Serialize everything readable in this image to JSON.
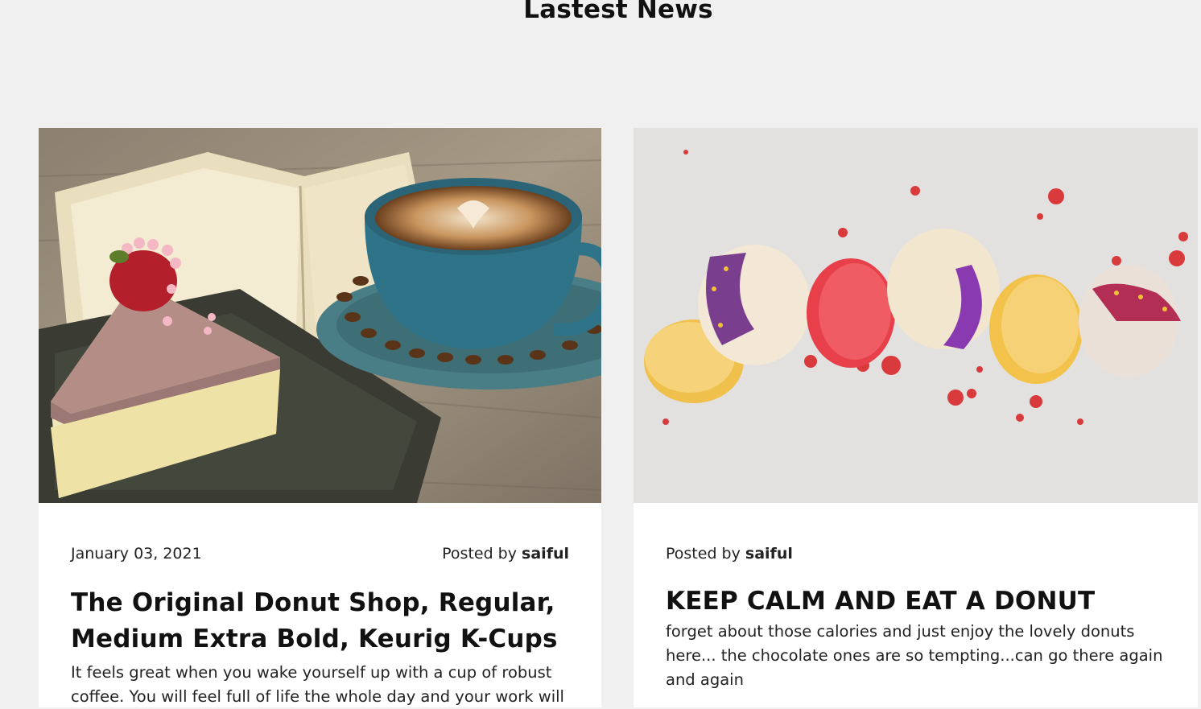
{
  "section": {
    "title": "Lastest News"
  },
  "posts": [
    {
      "date": "January 03, 2021",
      "posted_by_prefix": "Posted by",
      "author": "saiful",
      "title": "The Original Donut Shop, Regular, Medium Extra Bold, Keurig K-Cups",
      "excerpt": "It feels great when you wake yourself up with a cup of robust coffee. You will feel full of life the whole day and your work will",
      "image": "cake-and-coffee-photo"
    },
    {
      "date": "",
      "posted_by_prefix": "Posted by",
      "author": "saiful",
      "title": "KEEP CALM AND EAT A DONUT",
      "excerpt": "forget about those calories and just enjoy the lovely donuts here... the chocolate ones are so tempting...can go there again and again",
      "image": "macarons-photo"
    }
  ]
}
